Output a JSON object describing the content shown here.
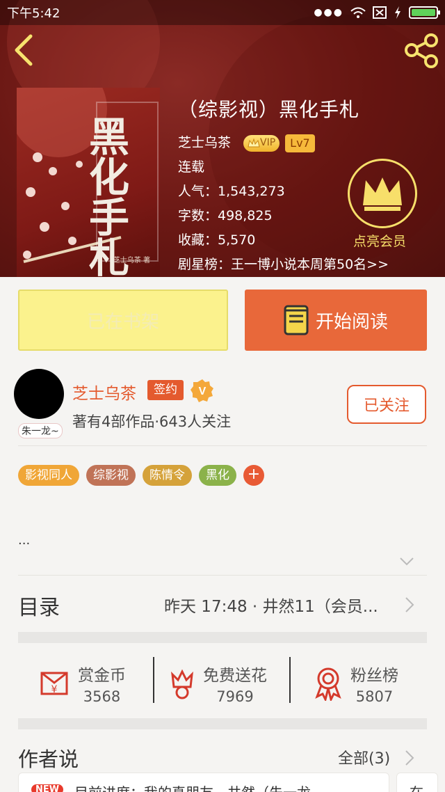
{
  "status_bar": {
    "time": "下午5:42"
  },
  "book": {
    "title": "（综影视）黑化手札",
    "author": "芝士乌茶",
    "vip": "VIP",
    "level": "Lv7",
    "status": "连载",
    "popularity": "人气：1,543,273",
    "word_count": "字数：498,825",
    "favorites": "收藏：5,570",
    "ranking": "剧星榜：王一博小说本周第50名>>",
    "cover_title": "黑化手札",
    "cover_author": "芝士乌茶 著"
  },
  "membership": {
    "label": "点亮会员"
  },
  "actions": {
    "shelf_label": "已在书架",
    "read_label": "开始阅读"
  },
  "author_block": {
    "avatar_tag": "朱一龙~",
    "name": "芝士乌茶",
    "sign_label": "签约",
    "v_label": "V",
    "meta": "著有4部作品·643人关注",
    "follow_label": "已关注"
  },
  "tags": [
    {
      "label": "影视同人",
      "color": "#f0a637"
    },
    {
      "label": "综影视",
      "color": "#c07357"
    },
    {
      "label": "陈情令",
      "color": "#d5a23a"
    },
    {
      "label": "黑化",
      "color": "#8bb24a"
    }
  ],
  "tag_add": "+",
  "summary": {
    "text": "..."
  },
  "catalog": {
    "label": "目录",
    "info": "昨天 17:48 · 井然11（会员..."
  },
  "stats": [
    {
      "label": "赏金币",
      "value": "3568",
      "icon": "envelope-icon"
    },
    {
      "label": "免费送花",
      "value": "7969",
      "icon": "flower-icon"
    },
    {
      "label": "粉丝榜",
      "value": "5807",
      "icon": "medal-icon"
    }
  ],
  "author_says": {
    "label": "作者说",
    "all_label": "全部(3)"
  },
  "posts": [
    {
      "badge": "NEW",
      "text": "目前进度：我的真朋友，井然（朱一龙..."
    },
    {
      "text": "在..."
    }
  ],
  "colors": {
    "accent": "#e8683a",
    "hero": "#6b1814",
    "gold": "#f7df6a"
  }
}
